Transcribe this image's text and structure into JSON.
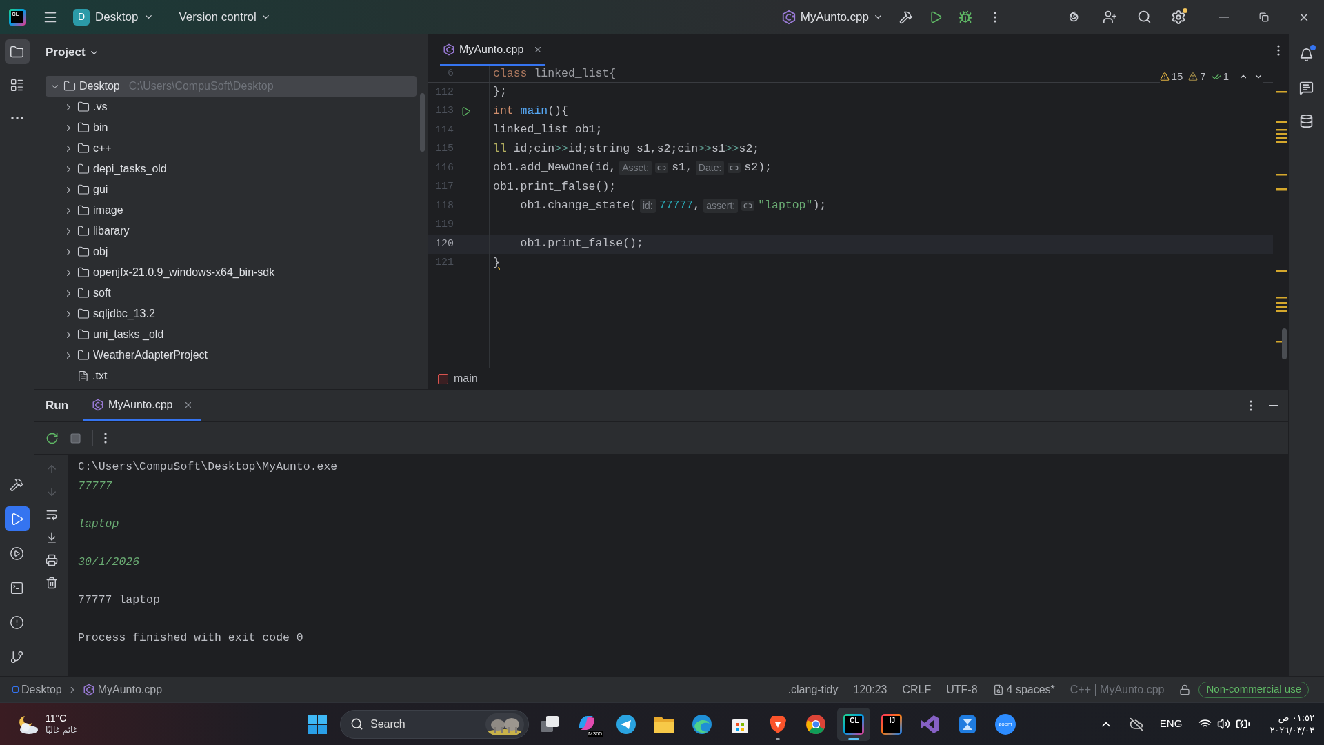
{
  "title_bar": {
    "logo_text": "CL",
    "project": {
      "initial": "D",
      "name": "Desktop"
    },
    "vcs": "Version control",
    "run_config": "MyAunto.cpp"
  },
  "left_toolbar": {
    "top": [
      {
        "kind": "folder",
        "selected": true
      },
      {
        "kind": "structure",
        "selected": false
      },
      {
        "kind": "more",
        "selected": false
      }
    ],
    "bottom": [
      {
        "kind": "build",
        "selected": false
      },
      {
        "kind": "run",
        "selected": true
      },
      {
        "kind": "services",
        "selected": false
      },
      {
        "kind": "terminal",
        "selected": false
      },
      {
        "kind": "problems",
        "selected": false
      },
      {
        "kind": "git",
        "selected": false
      }
    ]
  },
  "project": {
    "title": "Project",
    "tree": [
      {
        "kind": "folder",
        "name": "Desktop",
        "path": "C:\\Users\\CompuSoft\\Desktop",
        "expanded": true,
        "selected": true,
        "children": [
          {
            "kind": "folder",
            "name": ".vs",
            "expanded": false,
            "selected": false
          },
          {
            "kind": "folder",
            "name": "bin",
            "expanded": false,
            "selected": false
          },
          {
            "kind": "folder",
            "name": "c++",
            "expanded": false,
            "selected": false
          },
          {
            "kind": "folder",
            "name": "depi_tasks_old",
            "expanded": false,
            "selected": false
          },
          {
            "kind": "folder",
            "name": "gui",
            "expanded": false,
            "selected": false
          },
          {
            "kind": "folder",
            "name": "image",
            "expanded": false,
            "selected": false
          },
          {
            "kind": "folder",
            "name": "libarary",
            "expanded": false,
            "selected": false
          },
          {
            "kind": "folder",
            "name": "obj",
            "expanded": false,
            "selected": false
          },
          {
            "kind": "folder",
            "name": "openjfx-21.0.9_windows-x64_bin-sdk",
            "expanded": false,
            "selected": false
          },
          {
            "kind": "folder",
            "name": "soft",
            "expanded": false,
            "selected": false
          },
          {
            "kind": "folder",
            "name": "sqljdbc_13.2",
            "expanded": false,
            "selected": false
          },
          {
            "kind": "folder",
            "name": "uni_tasks _old",
            "expanded": false,
            "selected": false
          },
          {
            "kind": "folder",
            "name": "WeatherAdapterProject",
            "expanded": false,
            "selected": false
          },
          {
            "kind": "file",
            "name": ".txt",
            "selected": false
          }
        ]
      }
    ]
  },
  "editor": {
    "tabs": [
      {
        "label": "MyAunto.cpp",
        "selected": true
      }
    ],
    "inspections": {
      "warnings": "15",
      "weak_warnings": "7",
      "ok": "1"
    },
    "lines": [
      {
        "number": "6",
        "kind": "sticky",
        "current": false,
        "run": false,
        "tokens": [
          {
            "kind": "keyword",
            "text": "class"
          },
          {
            "kind": "plain",
            "text": " linked_list{"
          }
        ]
      },
      {
        "number": "112",
        "kind": "code",
        "current": false,
        "run": false,
        "tokens": [
          {
            "kind": "plain",
            "text": "};"
          }
        ]
      },
      {
        "number": "113",
        "kind": "code",
        "current": false,
        "run": true,
        "tokens": [
          {
            "kind": "keyword",
            "text": "int "
          },
          {
            "kind": "function",
            "text": "main"
          },
          {
            "kind": "plain",
            "text": "(){"
          }
        ]
      },
      {
        "number": "114",
        "kind": "code",
        "current": false,
        "run": false,
        "tokens": [
          {
            "kind": "plain",
            "text": "linked_list ob1;"
          }
        ]
      },
      {
        "number": "115",
        "kind": "code",
        "current": false,
        "run": false,
        "tokens": [
          {
            "kind": "type",
            "text": "ll"
          },
          {
            "kind": "plain",
            "text": " id;cin"
          },
          {
            "kind": "operator",
            "text": ">>"
          },
          {
            "kind": "plain",
            "text": "id;string s1,s2;cin"
          },
          {
            "kind": "operator",
            "text": ">>"
          },
          {
            "kind": "plain",
            "text": "s1"
          },
          {
            "kind": "operator",
            "text": ">>"
          },
          {
            "kind": "plain",
            "text": "s2;"
          }
        ]
      },
      {
        "number": "116",
        "kind": "code",
        "current": false,
        "run": false,
        "tokens": [
          {
            "kind": "plain",
            "text": "ob1.add_NewOne(id,"
          },
          {
            "kind": "hint",
            "text": "Asset:"
          },
          {
            "kind": "reference"
          },
          {
            "kind": "plain",
            "text": "s1,"
          },
          {
            "kind": "hint",
            "text": "Date:"
          },
          {
            "kind": "reference"
          },
          {
            "kind": "plain",
            "text": "s2);"
          }
        ]
      },
      {
        "number": "117",
        "kind": "code",
        "current": false,
        "run": false,
        "tokens": [
          {
            "kind": "plain",
            "text": "ob1.print_false();"
          }
        ]
      },
      {
        "number": "118",
        "kind": "code",
        "current": false,
        "run": false,
        "tokens": [
          {
            "kind": "plain",
            "text": "    ob1.change_state("
          },
          {
            "kind": "hint",
            "text": "id:"
          },
          {
            "kind": "number",
            "text": "77777"
          },
          {
            "kind": "plain",
            "text": ","
          },
          {
            "kind": "hint",
            "text": "assert:"
          },
          {
            "kind": "reference"
          },
          {
            "kind": "string",
            "text": "\"laptop\""
          },
          {
            "kind": "plain",
            "text": ");"
          }
        ]
      },
      {
        "number": "119",
        "kind": "code",
        "current": false,
        "run": false
      },
      {
        "number": "120",
        "kind": "code",
        "current": true,
        "run": false,
        "tokens": [
          {
            "kind": "plain",
            "text": "    ob1.print_false();"
          }
        ]
      },
      {
        "number": "121",
        "kind": "code",
        "current": false,
        "run": false,
        "tokens": [
          {
            "kind": "warning",
            "text": "}"
          }
        ]
      }
    ],
    "breadcrumb": "main"
  },
  "run_panel": {
    "title": "Run",
    "tabs": [
      {
        "label": "MyAunto.cpp",
        "selected": true
      }
    ],
    "side_actions": [
      {
        "kind": "up",
        "disabled": true
      },
      {
        "kind": "down",
        "disabled": true
      },
      {
        "kind": "wrap",
        "disabled": false
      },
      {
        "kind": "scroll_end",
        "disabled": false
      },
      {
        "kind": "print",
        "disabled": false
      },
      {
        "kind": "clear",
        "disabled": false
      }
    ],
    "output": [
      {
        "kind": "plain",
        "text": "C:\\Users\\CompuSoft\\Desktop\\MyAunto.exe"
      },
      {
        "kind": "input",
        "text": "77777"
      },
      {
        "kind": "blank"
      },
      {
        "kind": "input",
        "text": "laptop"
      },
      {
        "kind": "blank"
      },
      {
        "kind": "input",
        "text": "30/1/2026"
      },
      {
        "kind": "blank"
      },
      {
        "kind": "plain",
        "text": "77777 laptop"
      },
      {
        "kind": "blank"
      },
      {
        "kind": "plain",
        "text": "Process finished with exit code 0"
      }
    ]
  },
  "status_bar": {
    "breadcrumbs": [
      "Desktop",
      "MyAunto.cpp"
    ],
    "items": [
      {
        "kind": "text",
        "text": ".clang-tidy"
      },
      {
        "kind": "text",
        "text": "120:23"
      },
      {
        "kind": "text",
        "text": "CRLF"
      },
      {
        "kind": "text",
        "text": "UTF-8"
      },
      {
        "kind": "indent",
        "text": "4 spaces*"
      }
    ],
    "language": "C++",
    "file_context": "MyAunto.cpp",
    "license": "Non-commercial use"
  },
  "taskbar": {
    "weather": {
      "temp": "11°C",
      "desc": "غائم غالبًا"
    },
    "search": {
      "placeholder": "Search"
    },
    "apps": [
      {
        "kind": "copilot",
        "label": "M365",
        "selected": false,
        "running": false
      },
      {
        "kind": "telegram",
        "selected": false,
        "running": false
      },
      {
        "kind": "files",
        "selected": false,
        "running": false
      },
      {
        "kind": "edge",
        "selected": false,
        "running": false
      },
      {
        "kind": "store",
        "selected": false,
        "running": false
      },
      {
        "kind": "brave",
        "selected": false,
        "running": true
      },
      {
        "kind": "chrome",
        "selected": false,
        "running": false
      },
      {
        "kind": "clion",
        "label": "CL",
        "selected": true,
        "running": true
      },
      {
        "kind": "intellij",
        "label": "IJ",
        "selected": false,
        "running": false
      },
      {
        "kind": "vs",
        "selected": false,
        "running": false
      },
      {
        "kind": "compare",
        "selected": false,
        "running": false
      },
      {
        "kind": "zoom",
        "label": "zoom",
        "selected": false,
        "running": false
      }
    ],
    "language": "ENG",
    "clock": {
      "time": "٠١:٥٢ ص",
      "date": "٢٠٢٦/٠٣/٠٣"
    }
  }
}
